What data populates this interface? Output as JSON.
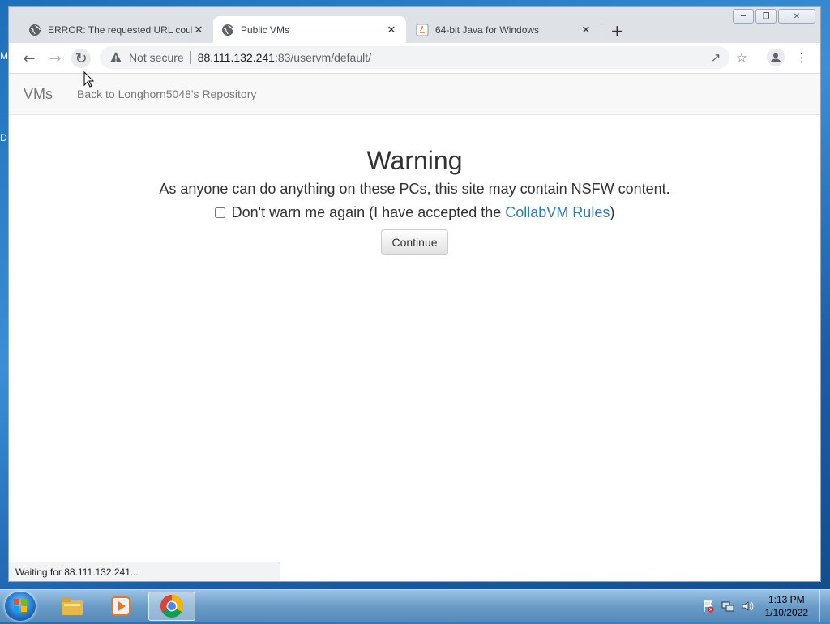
{
  "desktop": {
    "letters": [
      "M",
      "D"
    ]
  },
  "browser": {
    "tabs": [
      {
        "title": "ERROR: The requested URL could",
        "icon": "globe-icon",
        "active": false
      },
      {
        "title": "Public VMs",
        "icon": "globe-icon",
        "active": true
      },
      {
        "title": "64-bit Java for Windows",
        "icon": "java-icon",
        "active": false
      }
    ],
    "omnibox": {
      "security": "Not secure",
      "host": "88.111.132.241",
      "path": ":83/uservm/default/"
    },
    "status": "Waiting for 88.111.132.241..."
  },
  "page": {
    "navbar": {
      "brand": "VMs",
      "link": "Back to Longhorn5048's Repository"
    },
    "warning": {
      "title": "Warning",
      "message": "As anyone can do anything on these PCs, this site may contain NSFW content.",
      "checkbox_prefix": "Don't warn me again (I have accepted the ",
      "checkbox_link": "CollabVM Rules",
      "checkbox_suffix": ")",
      "checked": false,
      "button": "Continue"
    }
  },
  "taskbar": {
    "pinned": [
      "windows-explorer-icon",
      "media-player-icon",
      "chrome-icon"
    ],
    "clock": {
      "time": "1:13 PM",
      "date": "1/10/2022"
    }
  },
  "colors": {
    "link": "#337ab7",
    "tab_active": "#ffffff",
    "tabstrip": "#dee1e6"
  }
}
